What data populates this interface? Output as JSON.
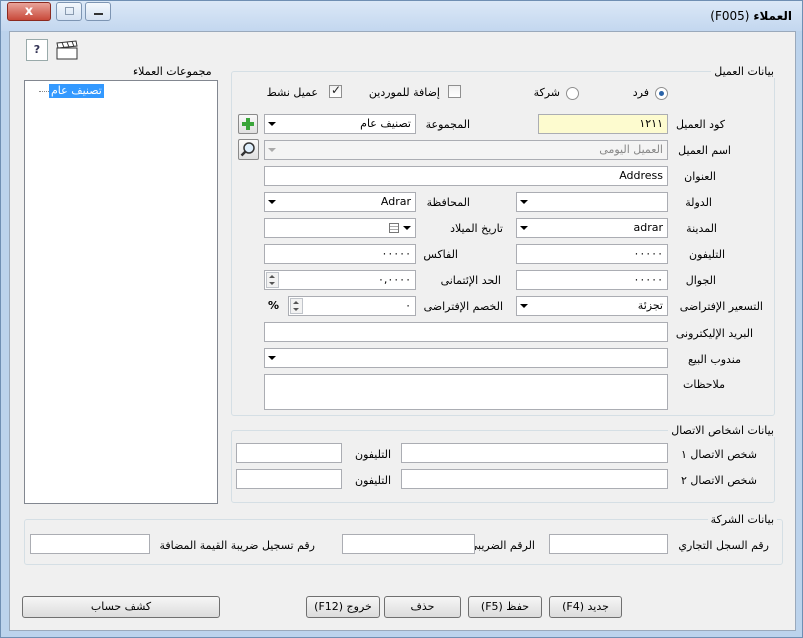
{
  "window": {
    "title": "العملاء",
    "code": "(F005)",
    "close_glyph": "x"
  },
  "toolbar": {
    "help_icon": "help-icon",
    "clapper_icon": "clapperboard-icon"
  },
  "groups_panel": {
    "title": "مجموعات العملاء",
    "items": [
      {
        "label": "تصنيف عام",
        "selected": true
      }
    ]
  },
  "customer": {
    "section_title": "بيانات العميل",
    "type_options": [
      {
        "label": "فرد",
        "selected": true
      },
      {
        "label": "شركة",
        "selected": false
      }
    ],
    "add_to_suppliers": {
      "label": "إضافة للموردين",
      "checked": false
    },
    "active_customer": {
      "label": "عميل نشط",
      "checked": true
    },
    "code": {
      "label": "كود العميل",
      "value": "١٢١١"
    },
    "group": {
      "label": "المجموعة",
      "value": "تصنيف عام"
    },
    "name": {
      "label": "اسم العميل",
      "placeholder": "العميل اليومى"
    },
    "address": {
      "label": "العنوان",
      "value": "Address"
    },
    "country": {
      "label": "الدولة",
      "value": ""
    },
    "governorate": {
      "label": "المحافظة",
      "value": "Adrar"
    },
    "city": {
      "label": "المدينة",
      "value": "adrar"
    },
    "birth_date": {
      "label": "تاريخ الميلاد",
      "value": ""
    },
    "phone": {
      "label": "التليفون",
      "value": "٠٠٠٠٠"
    },
    "fax": {
      "label": "الفاكس",
      "value": "٠٠٠٠٠"
    },
    "mobile": {
      "label": "الجوال",
      "value": "٠٠٠٠٠"
    },
    "credit_limit": {
      "label": "الحد الإئتمانى",
      "value": "٠,٠٠٠٠"
    },
    "default_pricing": {
      "label": "التسعير الإفتراضى",
      "value": "تجزئة"
    },
    "default_discount": {
      "label": "الخصم الإفتراضى",
      "value": "٠",
      "unit": "%"
    },
    "email": {
      "label": "البريد الإليكترونى",
      "value": ""
    },
    "sales_rep": {
      "label": "مندوب البيع",
      "value": ""
    },
    "notes": {
      "label": "ملاحظات",
      "value": ""
    }
  },
  "contacts": {
    "section_title": "بيانات اشخاص الاتصال",
    "rows": [
      {
        "label": "شخص الاتصال ١",
        "phone_label": "التليفون"
      },
      {
        "label": "شخص الاتصال ٢",
        "phone_label": "التليفون"
      }
    ]
  },
  "company": {
    "section_title": "بيانات الشركة",
    "commercial_register": "رقم السجل التجاري",
    "tax_number": "الرقم الضريبى",
    "vat_number": "رقم تسجيل ضريبة القيمة المضافة"
  },
  "buttons": {
    "new": "جديد (F4)",
    "save": "حفظ (F5)",
    "delete": "حذف",
    "exit": "خروج (F12)",
    "statement": "كشف حساب"
  },
  "colors": {
    "accent": "#3399ff",
    "code_field_bg": "#fdfbcf",
    "close_button": "#c8493a",
    "add_icon": "#3aa53a"
  }
}
